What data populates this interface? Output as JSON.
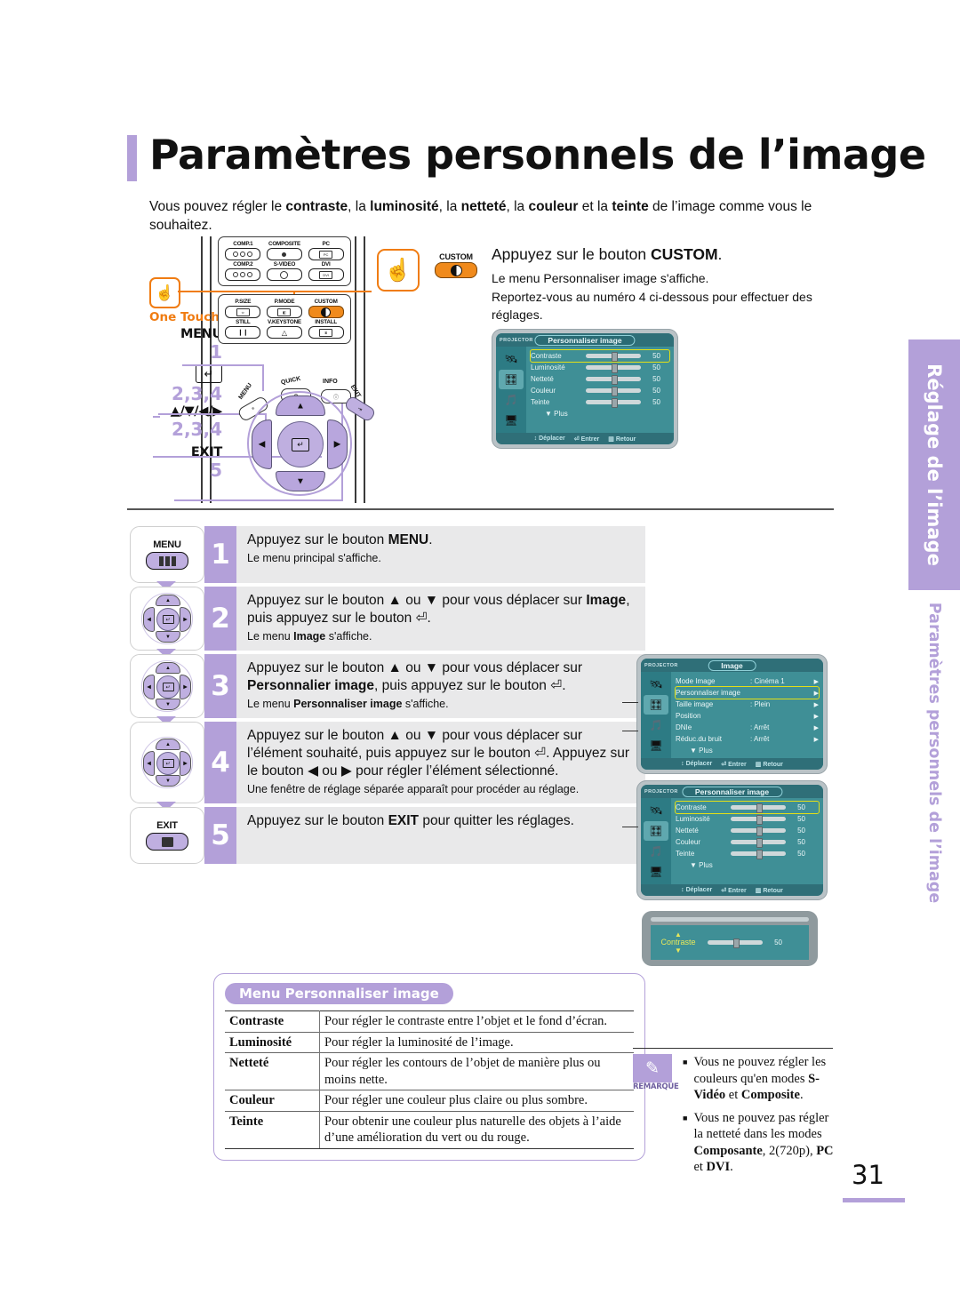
{
  "page": {
    "title": "Paramètres personnels de l’image",
    "intro_parts": [
      {
        "t": "Vous pouvez régler le ",
        "b": false
      },
      {
        "t": "contraste",
        "b": true
      },
      {
        "t": ", la ",
        "b": false
      },
      {
        "t": "luminosité",
        "b": true
      },
      {
        "t": ", la ",
        "b": false
      },
      {
        "t": "netteté",
        "b": true
      },
      {
        "t": ", la ",
        "b": false
      },
      {
        "t": "couleur",
        "b": true
      },
      {
        "t": " et la ",
        "b": false
      },
      {
        "t": "teinte",
        "b": true
      },
      {
        "t": " de l’image comme vous le souhaitez.",
        "b": false
      }
    ],
    "page_number": "31",
    "accent_purple": "#b3a0d9",
    "accent_orange": "#f07c12",
    "osd_teal": "#3f8f96",
    "osd_highlight": "#e4e016"
  },
  "side_tabs": {
    "tab_top": "Réglage de l’image",
    "tab_bottom": "Paramètres personnels de l’image"
  },
  "remote": {
    "one_touch_label": "One Touch",
    "one_touch_icon": "hand-press-icon",
    "source_buttons": [
      {
        "label": "COMP.1",
        "icon": "three-dots-icon"
      },
      {
        "label": "COMPOSITE",
        "icon": "single-dot-icon"
      },
      {
        "label": "PC",
        "icon": "pc-plug-icon"
      },
      {
        "label": "COMP.2",
        "icon": "three-dots-icon"
      },
      {
        "label": "S-VIDEO",
        "icon": "s-video-icon"
      },
      {
        "label": "DVI",
        "icon": "dvi-plug-icon"
      }
    ],
    "function_buttons": [
      {
        "label": "P.SIZE",
        "icon": "picture-size-icon"
      },
      {
        "label": "P.MODE",
        "icon": "picture-mode-icon"
      },
      {
        "label": "CUSTOM",
        "icon": "contrast-half-circle-icon"
      },
      {
        "label": "STILL",
        "icon": "pause-icon"
      },
      {
        "label": "V.KEYSTONE",
        "icon": "keystone-icon"
      },
      {
        "label": "INSTALL",
        "icon": "install-icon"
      }
    ],
    "pad_buttons": [
      {
        "label": "MENU",
        "icon": "menu-icon"
      },
      {
        "label": "QUICK",
        "icon": "quick-icon"
      },
      {
        "label": "INFO",
        "icon": "info-icon"
      },
      {
        "label": "EXIT",
        "icon": "exit-icon"
      }
    ],
    "key_legend": [
      {
        "key": "MENU",
        "steps": "1"
      },
      {
        "key": "⏎",
        "steps": "2,3,4"
      },
      {
        "key": "▲/▼/◀/▶",
        "steps": "2,3,4"
      },
      {
        "key": "EXIT",
        "steps": "5"
      }
    ]
  },
  "custom_callout": {
    "button_label": "CUSTOM",
    "hand_icon": "hand-press-icon",
    "heading_pre": "Appuyez sur le bouton ",
    "heading_bold": "CUSTOM",
    "heading_post": ".",
    "body_line1": "Le menu Personnaliser image s'affiche.",
    "body_line2": "Reportez-vous au numéro 4 ci-dessous pour effectuer des",
    "body_line3": "réglages."
  },
  "osd_custom_top": {
    "device": "PROJECTOR",
    "title": "Personnaliser image",
    "icons": [
      "setup-icon",
      "picture-icon",
      "sound-icon",
      "install-icon"
    ],
    "selected_icon_index": 1,
    "rows": [
      {
        "name": "Contraste",
        "value": "50",
        "highlight": true
      },
      {
        "name": "Luminosité",
        "value": "50",
        "highlight": false
      },
      {
        "name": "Netteté",
        "value": "50",
        "highlight": false
      },
      {
        "name": "Couleur",
        "value": "50",
        "highlight": false
      },
      {
        "name": "Teinte",
        "value": "50",
        "highlight": false
      }
    ],
    "more": "▼ Plus",
    "footer": [
      {
        "icon": "↕",
        "label": "Déplacer"
      },
      {
        "icon": "⏎",
        "label": "Entrer"
      },
      {
        "icon": "▥",
        "label": "Retour"
      }
    ]
  },
  "osd_image_menu": {
    "device": "PROJECTOR",
    "title": "Image",
    "rows": [
      {
        "name": "Mode Image",
        "value": ": Cinéma 1",
        "highlight": false
      },
      {
        "name": "Personnaliser image",
        "value": "",
        "highlight": true
      },
      {
        "name": "Taille image",
        "value": ": Plein",
        "highlight": false
      },
      {
        "name": "Position",
        "value": "",
        "highlight": false
      },
      {
        "name": "DNIe",
        "value": ": Arrêt",
        "highlight": false
      },
      {
        "name": "Réduc.du bruit",
        "value": ": Arrêt",
        "highlight": false
      }
    ],
    "more": "▼ Plus",
    "footer": [
      {
        "icon": "↕",
        "label": "Déplacer"
      },
      {
        "icon": "⏎",
        "label": "Entrer"
      },
      {
        "icon": "▥",
        "label": "Retour"
      }
    ]
  },
  "osd_custom_bottom": {
    "device": "PROJECTOR",
    "title": "Personnaliser image",
    "rows": [
      {
        "name": "Contraste",
        "value": "50",
        "highlight": true
      },
      {
        "name": "Luminosité",
        "value": "50",
        "highlight": false
      },
      {
        "name": "Netteté",
        "value": "50",
        "highlight": false
      },
      {
        "name": "Couleur",
        "value": "50",
        "highlight": false
      },
      {
        "name": "Teinte",
        "value": "50",
        "highlight": false
      }
    ],
    "more": "▼ Plus",
    "footer": [
      {
        "icon": "↕",
        "label": "Déplacer"
      },
      {
        "icon": "⏎",
        "label": "Entrer"
      },
      {
        "icon": "▥",
        "label": "Retour"
      }
    ]
  },
  "osd_adjust_popup": {
    "name": "Contraste",
    "value": "50",
    "up_arrow": "▲",
    "down_arrow": "▼"
  },
  "steps": [
    {
      "number": "1",
      "icon": "remote-menu-button-icon",
      "icon_label": "MENU",
      "main": [
        {
          "t": "Appuyez sur le bouton ",
          "b": false
        },
        {
          "t": "MENU",
          "b": true
        },
        {
          "t": ".",
          "b": false
        }
      ],
      "sub": [
        {
          "t": "Le menu principal s'affiche.",
          "b": false
        }
      ]
    },
    {
      "number": "2",
      "icon": "remote-navigation-pad-icon",
      "icon_label": "",
      "main": [
        {
          "t": "Appuyez sur le bouton ▲ ou ▼ pour vous déplacer sur ",
          "b": false
        },
        {
          "t": "Image",
          "b": true
        },
        {
          "t": ", puis appuyez sur le bouton ⏎.",
          "b": false
        }
      ],
      "sub": [
        {
          "t": "Le menu ",
          "b": false
        },
        {
          "t": "Image",
          "b": true
        },
        {
          "t": " s'affiche.",
          "b": false
        }
      ]
    },
    {
      "number": "3",
      "icon": "remote-navigation-pad-icon",
      "icon_label": "",
      "main": [
        {
          "t": "Appuyez sur le bouton ▲ ou ▼ pour vous déplacer sur ",
          "b": false
        },
        {
          "t": "Personnalier image",
          "b": true
        },
        {
          "t": ", puis appuyez sur le bouton ⏎.",
          "b": false
        }
      ],
      "sub": [
        {
          "t": "Le menu ",
          "b": false
        },
        {
          "t": "Personnaliser image",
          "b": true
        },
        {
          "t": " s'affiche.",
          "b": false
        }
      ]
    },
    {
      "number": "4",
      "icon": "remote-navigation-pad-icon",
      "icon_label": "",
      "main": [
        {
          "t": "Appuyez sur le bouton ▲ ou ▼ pour vous déplacer sur l’élément souhaité, puis appuyez sur le bouton ⏎. Appuyez sur le bouton ◀ ou ▶ pour régler l’élément sélectionné.",
          "b": false
        }
      ],
      "sub": [
        {
          "t": "Une fenêtre de réglage séparée apparaît pour procéder au réglage.",
          "b": false
        }
      ]
    },
    {
      "number": "5",
      "icon": "remote-exit-button-icon",
      "icon_label": "EXIT",
      "main": [
        {
          "t": "Appuyez sur le bouton ",
          "b": false
        },
        {
          "t": "EXIT",
          "b": true
        },
        {
          "t": " pour quitter les réglages.",
          "b": false
        }
      ],
      "sub": []
    }
  ],
  "table": {
    "badge": "Menu Personnaliser image",
    "rows": [
      {
        "key": "Contraste",
        "desc": "Pour régler le contraste entre l’objet et le fond d’écran."
      },
      {
        "key": "Luminosité",
        "desc": "Pour régler la luminosité de l’image."
      },
      {
        "key": "Netteté",
        "desc": "Pour régler les contours de l’objet de manière plus ou moins nette."
      },
      {
        "key": "Couleur",
        "desc": "Pour régler une couleur plus claire ou plus sombre."
      },
      {
        "key": "Teinte",
        "desc": "Pour obtenir une couleur plus naturelle des objets à l’aide d’une amélioration du vert ou du rouge."
      }
    ]
  },
  "remark": {
    "label": "REMARQUE",
    "icon": "pencil-note-icon",
    "items": [
      [
        {
          "t": "Vous ne pouvez régler les couleurs qu'en modes ",
          "b": false
        },
        {
          "t": "S-Vidéo",
          "b": true
        },
        {
          "t": " et ",
          "b": false
        },
        {
          "t": "Composite",
          "b": true
        },
        {
          "t": ".",
          "b": false
        }
      ],
      [
        {
          "t": "Vous ne pouvez pas régler la netteté dans les modes ",
          "b": false
        },
        {
          "t": "Composante",
          "b": true
        },
        {
          "t": ", ",
          "b": false
        },
        {
          "t": "2(720p)",
          "b": false
        },
        {
          "t": ", ",
          "b": false
        },
        {
          "t": "PC",
          "b": true
        },
        {
          "t": " et ",
          "b": false
        },
        {
          "t": "DVI",
          "b": true
        },
        {
          "t": ".",
          "b": false
        }
      ]
    ]
  }
}
